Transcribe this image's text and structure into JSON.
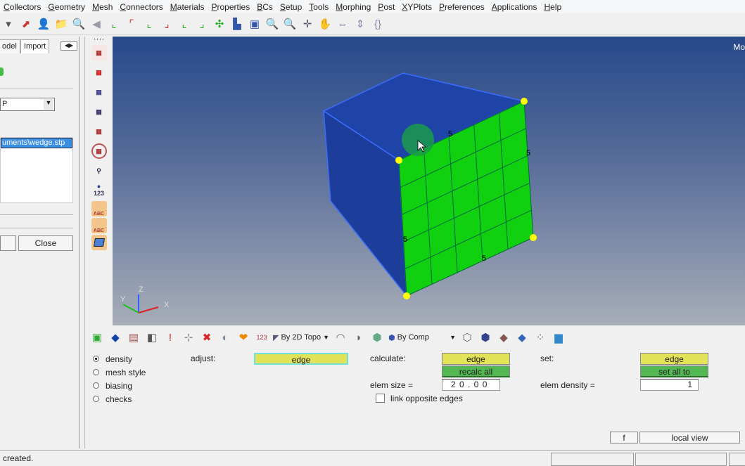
{
  "menu": [
    "Collectors",
    "Geometry",
    "Mesh",
    "Connectors",
    "Materials",
    "Properties",
    "BCs",
    "Setup",
    "Tools",
    "Morphing",
    "Post",
    "XYPlots",
    "Preferences",
    "Applications",
    "Help"
  ],
  "left_panel": {
    "tabs": [
      "odel",
      "Import"
    ],
    "dropdown_value": "P",
    "file_item": "uments\\wedge.stp",
    "close_label": "Close"
  },
  "vertical_toolbar": {
    "info_label": "123",
    "abc_label": "ABC"
  },
  "viewport": {
    "corner_label": "Mo",
    "edge_densities": [
      "5",
      "5",
      "5",
      "5"
    ],
    "axes": {
      "x": "X",
      "y": "Y",
      "z": "Z"
    },
    "colors": {
      "mesh": "#10d010",
      "solid": "#1e3fa0",
      "handles": "#ffff00"
    }
  },
  "bottom_toolbar": {
    "topo_select": "By 2D Topo",
    "comp_select": "By Comp"
  },
  "panel": {
    "modes": [
      {
        "label": "density",
        "selected": true
      },
      {
        "label": "mesh style",
        "selected": false
      },
      {
        "label": "biasing",
        "selected": false
      },
      {
        "label": "checks",
        "selected": false
      }
    ],
    "adjust_label": "adjust:",
    "adjust_button": "edge",
    "calculate_label": "calculate:",
    "calculate_button": "edge",
    "recalc_button": "recalc all",
    "elem_size_label": "elem size =",
    "elem_size_value": "2 0 . 0 0",
    "link_label": "link opposite edges",
    "link_checked": false,
    "set_label": "set:",
    "set_button": "edge",
    "set_all_button": "set all to",
    "elem_density_label": "elem density =",
    "elem_density_value": "1",
    "f_button": "f",
    "local_view_button": "local view"
  },
  "status": {
    "message": "created."
  }
}
